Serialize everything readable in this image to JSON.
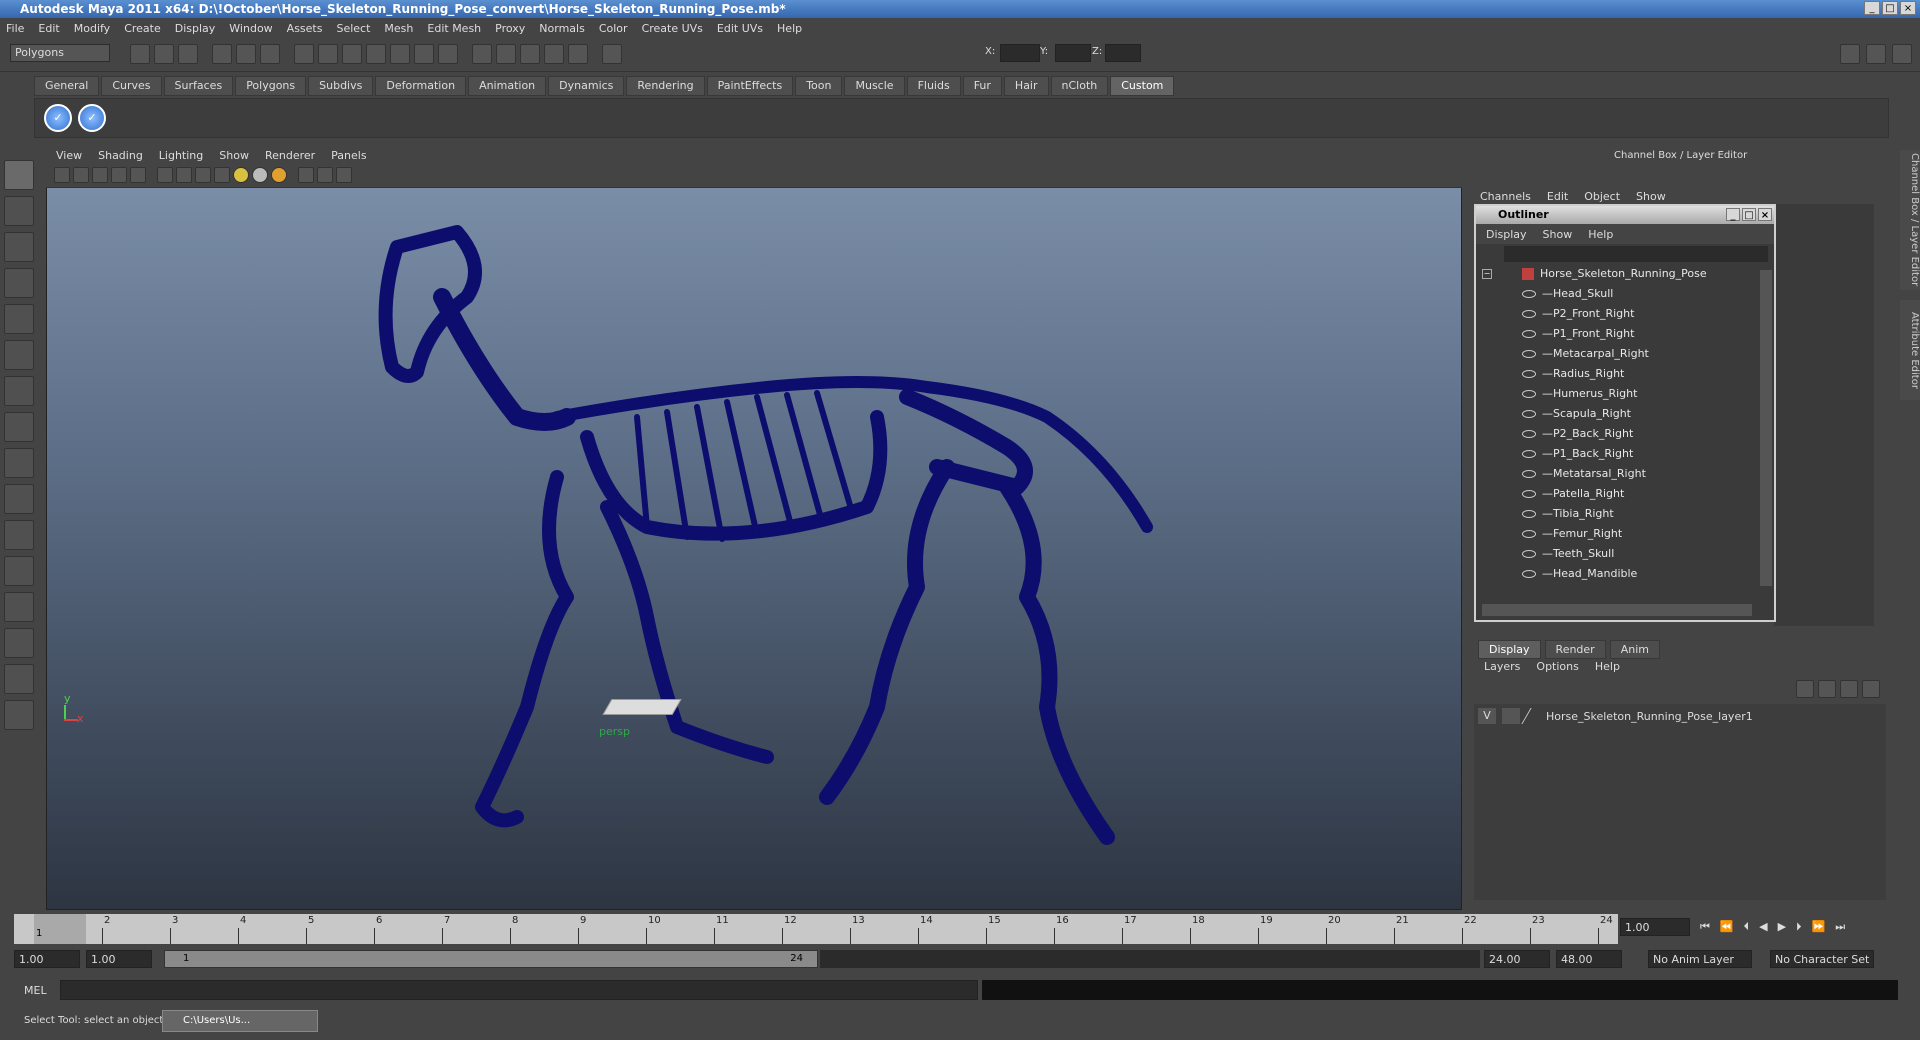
{
  "window": {
    "title": "Autodesk Maya 2011 x64: D:\\!October\\Horse_Skeleton_Running_Pose_convert\\Horse_Skeleton_Running_Pose.mb*"
  },
  "menubar": [
    "File",
    "Edit",
    "Modify",
    "Create",
    "Display",
    "Window",
    "Assets",
    "Select",
    "Mesh",
    "Edit Mesh",
    "Proxy",
    "Normals",
    "Color",
    "Create UVs",
    "Edit UVs",
    "Help"
  ],
  "status": {
    "mode": "Polygons",
    "x_label": "X:",
    "y_label": "Y:",
    "z_label": "Z:"
  },
  "shelf_tabs": [
    "General",
    "Curves",
    "Surfaces",
    "Polygons",
    "Subdivs",
    "Deformation",
    "Animation",
    "Dynamics",
    "Rendering",
    "PaintEffects",
    "Toon",
    "Muscle",
    "Fluids",
    "Fur",
    "Hair",
    "nCloth",
    "Custom"
  ],
  "shelf_active": "Custom",
  "viewport": {
    "menu": [
      "View",
      "Shading",
      "Lighting",
      "Show",
      "Renderer",
      "Panels"
    ],
    "camera": "persp",
    "axis_y": "y",
    "axis_x": "x",
    "model_color": "#0d0d6e"
  },
  "channelbox": {
    "title": "Channel Box / Layer Editor",
    "menu": [
      "Channels",
      "Edit",
      "Object",
      "Show"
    ]
  },
  "outliner": {
    "title": "Outliner",
    "menu": [
      "Display",
      "Show",
      "Help"
    ],
    "root": "Horse_Skeleton_Running_Pose",
    "items": [
      "Head_Skull",
      "P2_Front_Right",
      "P1_Front_Right",
      "Metacarpal_Right",
      "Radius_Right",
      "Humerus_Right",
      "Scapula_Right",
      "P2_Back_Right",
      "P1_Back_Right",
      "Metatarsal_Right",
      "Patella_Right",
      "Tibia_Right",
      "Femur_Right",
      "Teeth_Skull",
      "Head_Mandible"
    ]
  },
  "layers": {
    "tabs": [
      "Display",
      "Render",
      "Anim"
    ],
    "menu": [
      "Layers",
      "Options",
      "Help"
    ],
    "visibility": "V",
    "layer_name": "Horse_Skeleton_Running_Pose_layer1"
  },
  "timeline": {
    "ticks": [
      "1",
      "2",
      "3",
      "4",
      "5",
      "6",
      "7",
      "8",
      "9",
      "10",
      "11",
      "12",
      "13",
      "14",
      "15",
      "16",
      "17",
      "18",
      "19",
      "20",
      "21",
      "22",
      "23",
      "24"
    ],
    "current": "1.00",
    "current_marker": "1"
  },
  "range": {
    "start": "1.00",
    "start2": "1.00",
    "slider_start": "1",
    "slider_end": "24",
    "end": "24.00",
    "end2": "48.00",
    "anim_layer": "No Anim Layer",
    "character_set": "No Character Set"
  },
  "command": {
    "label": "MEL"
  },
  "help": {
    "text": "Select Tool: select an object",
    "task": "C:\\Users\\Us..."
  },
  "side_tabs": [
    "Channel Box / Layer Editor",
    "Attribute Editor"
  ]
}
